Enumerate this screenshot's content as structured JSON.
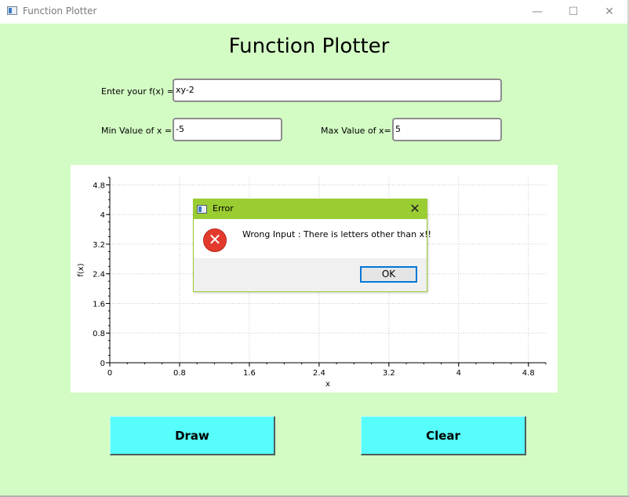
{
  "window": {
    "title": "Function Plotter",
    "minimize_glyph": "—",
    "maximize_glyph": "☐",
    "close_glyph": "✕",
    "app_icon": "app-window-icon"
  },
  "main": {
    "heading": "Function Plotter",
    "fx_label": "Enter your f(x) =",
    "fx_value": "xy-2",
    "min_label": "Min Value of x =",
    "min_value": "-5",
    "max_label": "Max Value of x=",
    "max_value": "5",
    "draw_label": "Draw",
    "clear_label": "Clear"
  },
  "colors": {
    "background": "#d3fcc4",
    "button": "#56fdfb",
    "dialog_title": "#9acd32",
    "error_icon": "#e23b2e",
    "focus_border": "#0078d7"
  },
  "chart_data": {
    "type": "line",
    "title": "",
    "xlabel": "x",
    "ylabel": "f(x)",
    "xlim": [
      0,
      5
    ],
    "ylim": [
      0,
      5
    ],
    "xticks": [
      "0",
      "0.8",
      "1.6",
      "2.4",
      "3.2",
      "4",
      "4.8"
    ],
    "yticks": [
      "0",
      "0.8",
      "1.6",
      "2.4",
      "3.2",
      "4",
      "4.8"
    ],
    "grid": true,
    "series": []
  },
  "dialog": {
    "title": "Error",
    "message": "Wrong Input : There is letters other than x!!",
    "ok_label": "OK",
    "close_glyph": "✕",
    "icon": "error-icon",
    "icon_glyph": "✕"
  }
}
